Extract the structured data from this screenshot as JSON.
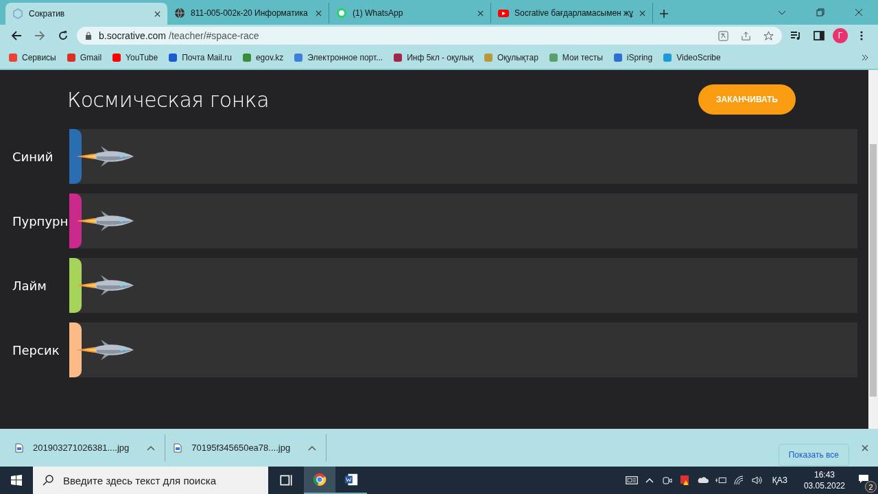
{
  "browser": {
    "tabs": [
      {
        "title": "Сократив",
        "selected": true
      },
      {
        "title": "811-005-002к-20 Информатика",
        "selected": false
      },
      {
        "title": "(1) WhatsApp",
        "selected": false
      },
      {
        "title": "Socrative бағдарламасымен жұ",
        "selected": false
      }
    ],
    "address": {
      "host": "b.socrative.com",
      "path": "/teacher/#space-race"
    },
    "profile": "Г",
    "bookmarks": [
      {
        "label": "Сервисы",
        "color": "#e94235"
      },
      {
        "label": "Gmail",
        "color": "#d93025"
      },
      {
        "label": "YouTube",
        "color": "#ff0000"
      },
      {
        "label": "Почта Mail.ru",
        "color": "#1a5ccf"
      },
      {
        "label": "egov.kz",
        "color": "#3c8a3c"
      },
      {
        "label": "Электронное порт...",
        "color": "#3d7fd9"
      },
      {
        "label": "Инф 5кл - оқулық",
        "color": "#a3244a"
      },
      {
        "label": "Оқулықтар",
        "color": "#b59a3a"
      },
      {
        "label": "Мои тесты",
        "color": "#5aa06a"
      },
      {
        "label": "iSpring",
        "color": "#2e6fd3"
      },
      {
        "label": "VideoScribe",
        "color": "#1e9ad6"
      }
    ]
  },
  "race": {
    "title": "Космическая гонка",
    "finish_button": "ЗАКАНЧИВАТЬ",
    "teams": [
      {
        "name": "Синий",
        "color": "#2a6db0"
      },
      {
        "name": "Пурпурн",
        "color": "#c92a8c"
      },
      {
        "name": "Лайм",
        "color": "#a6d45a"
      },
      {
        "name": "Персик",
        "color": "#fbbb88"
      }
    ]
  },
  "downloads": {
    "files": [
      "201903271026381....jpg",
      "70195f345650ea78....jpg"
    ],
    "show_all": "Показать все"
  },
  "taskbar": {
    "search_placeholder": "Введите здесь текст для поиска",
    "language": "ҚАЗ",
    "time": "16:43",
    "date": "03.05.2022",
    "notifications": "2"
  }
}
